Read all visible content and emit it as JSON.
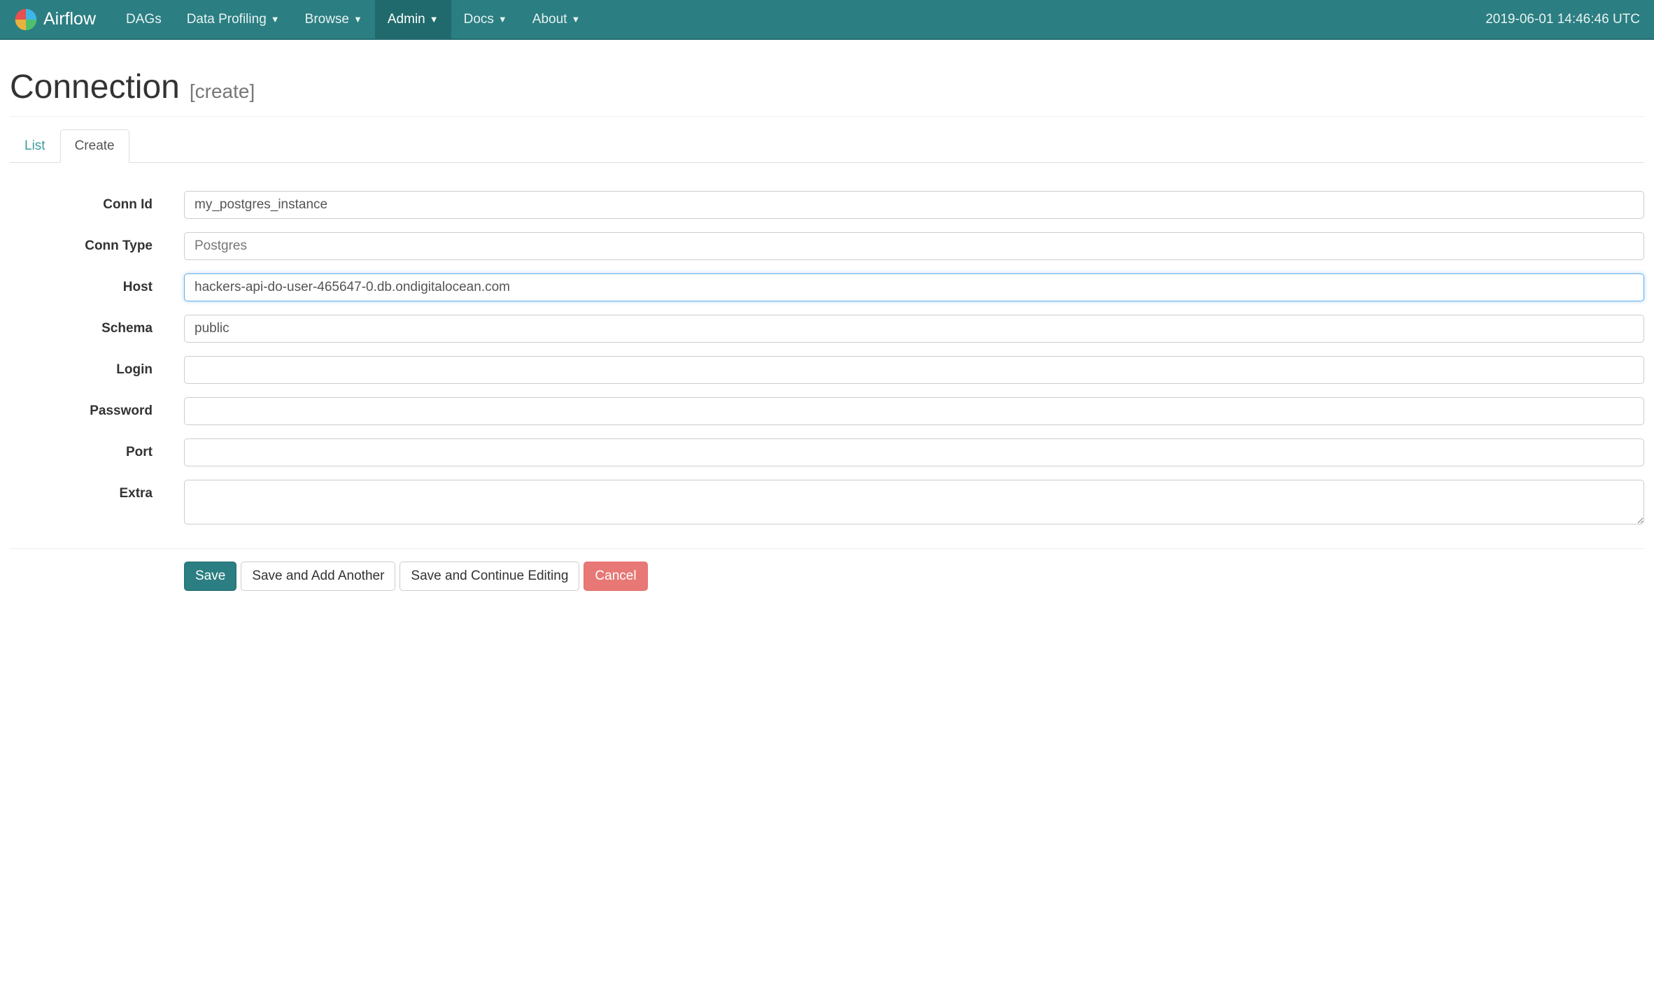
{
  "brand": "Airflow",
  "nav": {
    "items": [
      {
        "label": "DAGs",
        "dropdown": false
      },
      {
        "label": "Data Profiling",
        "dropdown": true
      },
      {
        "label": "Browse",
        "dropdown": true
      },
      {
        "label": "Admin",
        "dropdown": true
      },
      {
        "label": "Docs",
        "dropdown": true
      },
      {
        "label": "About",
        "dropdown": true
      }
    ],
    "timestamp": "2019-06-01 14:46:46 UTC"
  },
  "page": {
    "title": "Connection",
    "subtitle": "[create]"
  },
  "tabs": {
    "list": "List",
    "create": "Create"
  },
  "form": {
    "conn_id": {
      "label": "Conn Id",
      "value": "my_postgres_instance"
    },
    "conn_type": {
      "label": "Conn Type",
      "value": "Postgres"
    },
    "host": {
      "label": "Host",
      "value": "hackers-api-do-user-465647-0.db.ondigitalocean.com"
    },
    "schema": {
      "label": "Schema",
      "value": "public"
    },
    "login": {
      "label": "Login",
      "value": ""
    },
    "password": {
      "label": "Password",
      "value": ""
    },
    "port": {
      "label": "Port",
      "value": ""
    },
    "extra": {
      "label": "Extra",
      "value": ""
    }
  },
  "buttons": {
    "save": "Save",
    "save_add": "Save and Add Another",
    "save_cont": "Save and Continue Editing",
    "cancel": "Cancel"
  }
}
